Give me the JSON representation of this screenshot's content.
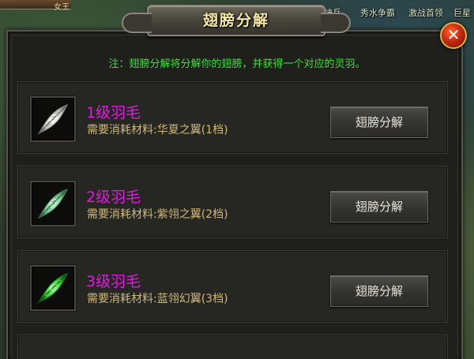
{
  "window": {
    "title": "翅膀分解",
    "close_label": "✕",
    "notice": "注：翅膀分解将分解你的翅膀，并获得一个对应的灵羽。"
  },
  "background": {
    "labels": [
      "神兵",
      "秀水争霸",
      "激战首领",
      "巨星"
    ],
    "corner_text": "女王"
  },
  "items": [
    {
      "name": "1级羽毛",
      "requirement": "需要消耗材料:华夏之翼(1档)",
      "button_label": "翅膀分解",
      "icon": "white-feather-icon",
      "color": "#e6e6e0"
    },
    {
      "name": "2级羽毛",
      "requirement": "需要消耗材料:紫翎之翼(2档)",
      "button_label": "翅膀分解",
      "icon": "pale-green-feather-icon",
      "color": "#8fd8a8"
    },
    {
      "name": "3级羽毛",
      "requirement": "需要消耗材料:蓝翎幻翼(3档)",
      "button_label": "翅膀分解",
      "icon": "green-feather-icon",
      "color": "#2ed830"
    }
  ],
  "colors": {
    "item_name": "#e01ae0",
    "notice": "#3ee03a",
    "requirement": "#d0b878",
    "title": "#f6e8a6"
  }
}
